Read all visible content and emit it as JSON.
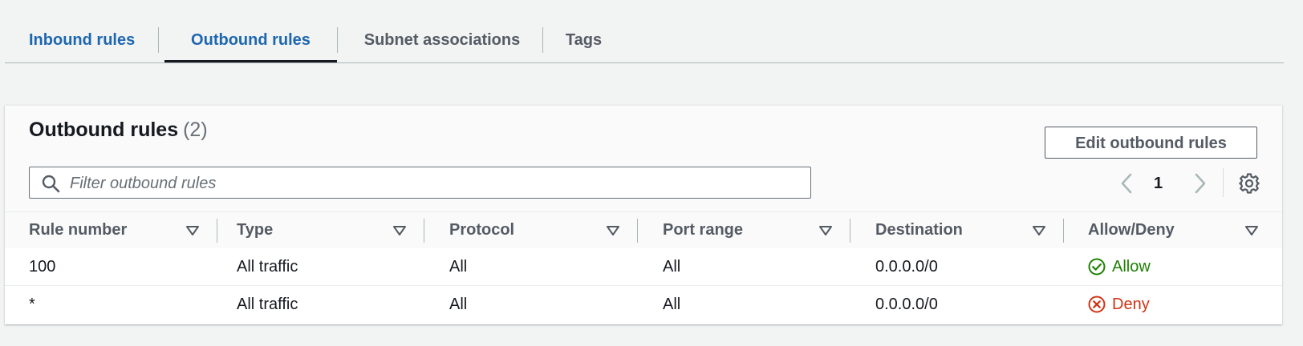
{
  "tabs": [
    {
      "label": "Inbound rules"
    },
    {
      "label": "Outbound rules"
    },
    {
      "label": "Subnet associations"
    },
    {
      "label": "Tags"
    }
  ],
  "panel": {
    "title": "Outbound rules",
    "count": "(2)",
    "edit_button": "Edit outbound rules",
    "filter_placeholder": "Filter outbound rules",
    "page": "1"
  },
  "table": {
    "headers": [
      "Rule number",
      "Type",
      "Protocol",
      "Port range",
      "Destination",
      "Allow/Deny"
    ],
    "rows": [
      {
        "rule": "100",
        "type": "All traffic",
        "protocol": "All",
        "port": "All",
        "destination": "0.0.0.0/0",
        "action": "Allow"
      },
      {
        "rule": "*",
        "type": "All traffic",
        "protocol": "All",
        "port": "All",
        "destination": "0.0.0.0/0",
        "action": "Deny"
      }
    ]
  },
  "colors": {
    "link": "#1d67b0",
    "allow": "#1d8102",
    "deny": "#d13212"
  },
  "icons": [
    "search-icon",
    "chevron-left-icon",
    "chevron-right-icon",
    "gear-icon",
    "sort-icon",
    "check-circle-icon",
    "x-circle-icon"
  ]
}
